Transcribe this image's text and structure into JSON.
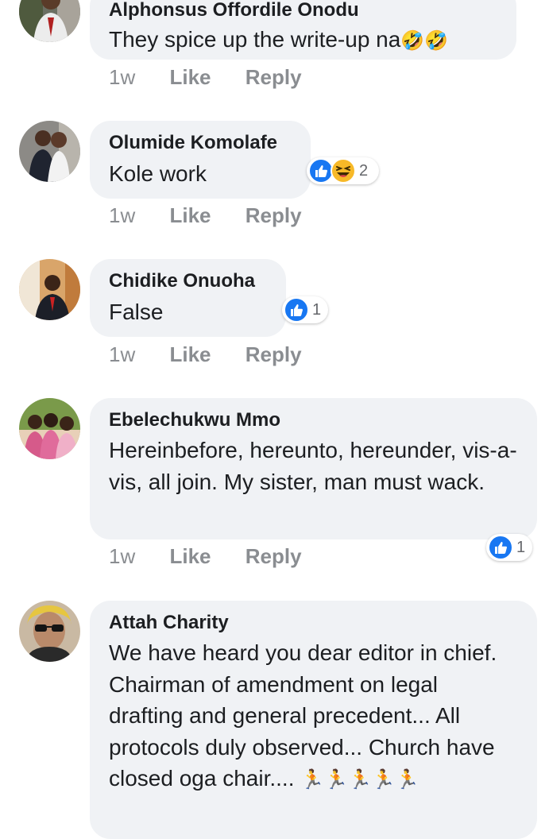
{
  "comments": [
    {
      "author": "Alphonsus Offordile Onodu",
      "text": "They spice up the write-up na",
      "emoji": "🤣🤣",
      "time": "1w",
      "like_label": "Like",
      "reply_label": "Reply"
    },
    {
      "author": "Olumide Komolafe",
      "text": "Kole work",
      "time": "1w",
      "like_label": "Like",
      "reply_label": "Reply",
      "reactions": {
        "types": [
          "like",
          "haha"
        ],
        "count": "2"
      }
    },
    {
      "author": "Chidike Onuoha",
      "text": "False",
      "time": "1w",
      "like_label": "Like",
      "reply_label": "Reply",
      "reactions": {
        "types": [
          "like"
        ],
        "count": "1"
      }
    },
    {
      "author": "Ebelechukwu Mmo",
      "text": "Hereinbefore, hereunto, hereunder, vis-a-vis, all join. My sister, man must wack.",
      "time": "1w",
      "like_label": "Like",
      "reply_label": "Reply",
      "reactions": {
        "types": [
          "like"
        ],
        "count": "1"
      }
    },
    {
      "author": "Attah Charity",
      "text": "We have heard you dear editor in chief. Chairman of amendment on legal drafting and general precedent... All protocols duly observed... Church have closed oga chair....",
      "emoji": "🏃🏃🏃🏃🏃"
    }
  ],
  "colors": {
    "bubble": "#f0f2f5",
    "meta_text": "#8a8d91",
    "like_blue": "#1877f2",
    "haha_yellow": "#f7b928"
  }
}
